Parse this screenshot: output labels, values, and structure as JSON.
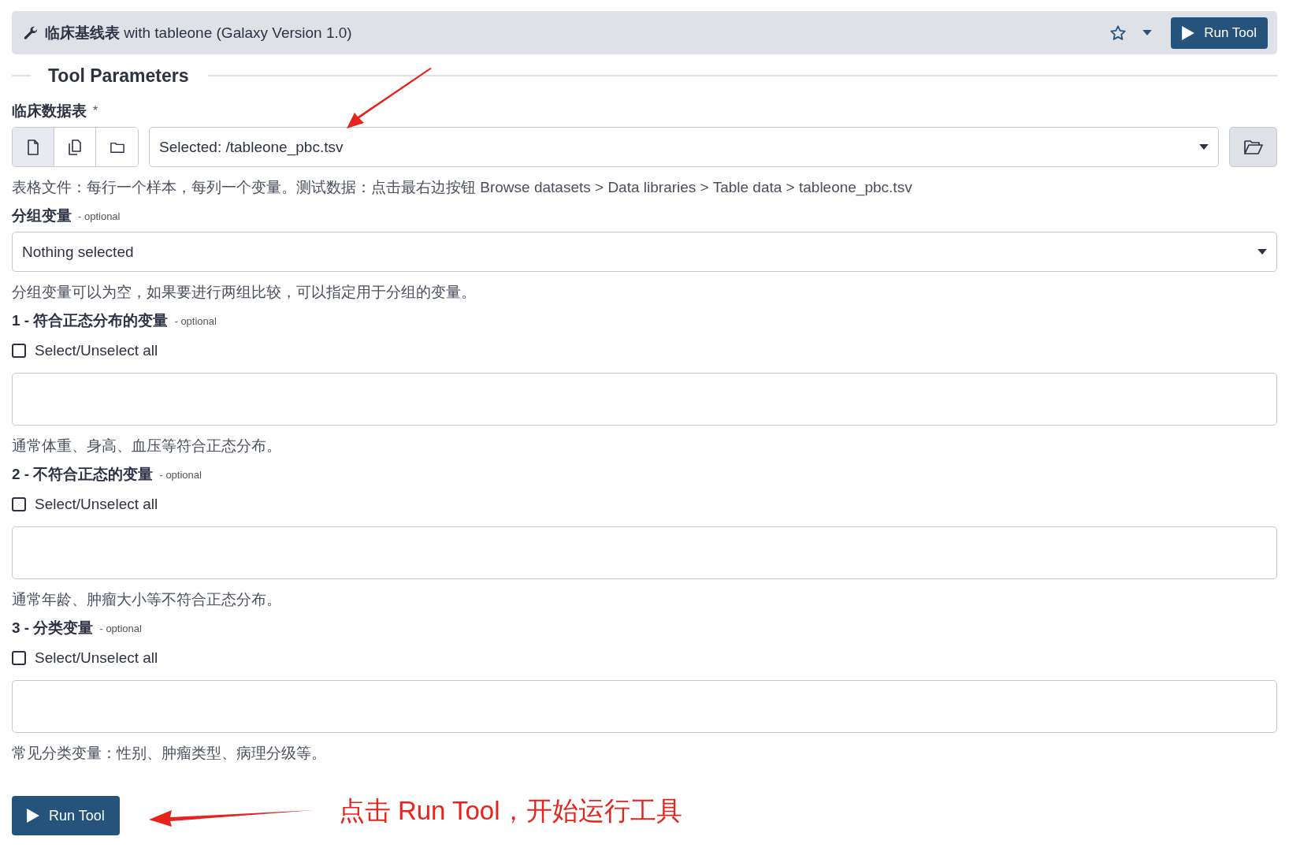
{
  "header": {
    "title_bold": "临床基线表",
    "title_rest": "with tableone (Galaxy Version 1.0)",
    "run_button": "Run Tool"
  },
  "section_title": "Tool Parameters",
  "params": [
    {
      "kind": "data",
      "label": "临床数据表",
      "required_mark": "*",
      "sources": [
        {
          "kind": "file",
          "selected": true
        },
        {
          "kind": "files",
          "selected": false
        },
        {
          "kind": "folder",
          "selected": false
        }
      ],
      "value": "Selected: /tableone_pbc.tsv",
      "help": "表格文件：每行一个样本，每列一个变量。测试数据：点击最右边按钮 Browse datasets > Data libraries > Table data > tableone_pbc.tsv"
    },
    {
      "kind": "select",
      "label": "分组变量",
      "optional": "- optional",
      "value": "Nothing selected",
      "help": "分组变量可以为空，如果要进行两组比较，可以指定用于分组的变量。"
    },
    {
      "kind": "multi",
      "label": "1 - 符合正态分布的变量",
      "optional": "- optional",
      "select_all": "Select/Unselect all",
      "checked": false,
      "help": "通常体重、身高、血压等符合正态分布。"
    },
    {
      "kind": "multi",
      "label": "2 - 不符合正态的变量",
      "optional": "- optional",
      "select_all": "Select/Unselect all",
      "checked": false,
      "help": "通常年龄、肿瘤大小等不符合正态分布。"
    },
    {
      "kind": "multi",
      "label": "3 - 分类变量",
      "optional": "- optional",
      "select_all": "Select/Unselect all",
      "checked": false,
      "help": "常见分类变量：性别、肿瘤类型、病理分级等。"
    }
  ],
  "run_button": "Run Tool",
  "annotation": "点击 Run Tool，开始运行工具"
}
